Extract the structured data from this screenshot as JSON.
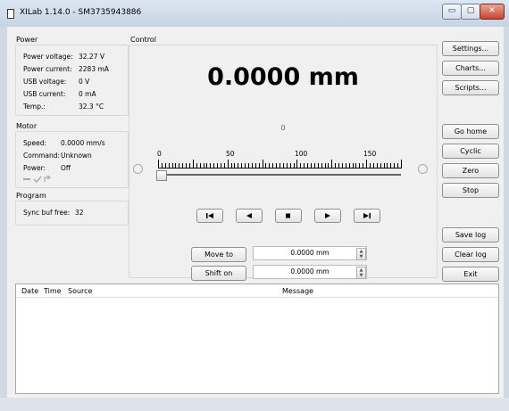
{
  "window": {
    "title": "XILab 1.14.0 - SM3735943886",
    "minimize": "▭",
    "maximize": "▢",
    "close": "✕"
  },
  "power": {
    "title": "Power",
    "rows": [
      {
        "label": "Power voltage:",
        "value": "32.27 V"
      },
      {
        "label": "Power current:",
        "value": "2283 mA"
      },
      {
        "label": "USB voltage:",
        "value": "0 V"
      },
      {
        "label": "USB current:",
        "value": "0 mA"
      },
      {
        "label": "Temp.:",
        "value": "32.3 °C"
      }
    ]
  },
  "motor": {
    "title": "Motor",
    "speed_label": "Speed:",
    "speed_value": "0.0000 mm/s",
    "command_label": "Command:",
    "command_value": "Unknown",
    "power_label": "Power:",
    "power_value": "Off"
  },
  "program": {
    "title": "Program",
    "sync_label": "Sync buf free:",
    "sync_value": "32"
  },
  "control": {
    "title": "Control",
    "position": "0.0000 mm",
    "position_small": "0",
    "scale_labels": [
      "0",
      "50",
      "100",
      "150"
    ],
    "move_to_label": "Move to",
    "move_to_value": "0.0000 mm",
    "shift_on_label": "Shift on",
    "shift_on_value": "0.0000 mm"
  },
  "buttons": {
    "settings": "Settings...",
    "charts": "Charts...",
    "scripts": "Scripts...",
    "go_home": "Go home",
    "cyclic": "Cyclic",
    "zero": "Zero",
    "stop": "Stop",
    "save_log": "Save log",
    "clear_log": "Clear log",
    "exit": "Exit"
  },
  "log": {
    "headers": {
      "date": "Date",
      "time": "Time",
      "source": "Source",
      "message": "Message"
    }
  }
}
